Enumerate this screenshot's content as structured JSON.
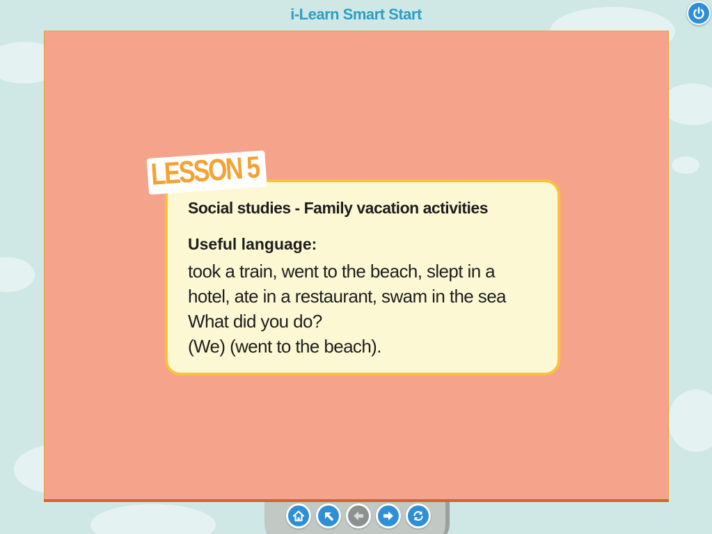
{
  "header": {
    "app_title": "i-Learn Smart Start",
    "power_icon": "power-icon"
  },
  "lesson": {
    "badge": "LESSON 5",
    "heading": "Social studies - Family vacation activities",
    "useful_language_title": "Useful language:",
    "lines": [
      "took a train, went to the beach, slept in a",
      "hotel, ate in a restaurant, swam in the sea",
      "What did you do?",
      "(We) (went to the beach)."
    ]
  },
  "navigation": {
    "buttons": [
      {
        "icon": "home-icon",
        "enabled": true
      },
      {
        "icon": "arrow-up-left-icon",
        "enabled": true
      },
      {
        "icon": "arrow-left-icon",
        "enabled": false
      },
      {
        "icon": "arrow-right-icon",
        "enabled": true
      },
      {
        "icon": "refresh-icon",
        "enabled": true
      }
    ]
  },
  "colors": {
    "background": "#cfe8e6",
    "slide": "#f6a38b",
    "card": "#fdf8d4",
    "card_border": "#f8c23a",
    "title": "#2b9fc4",
    "button": "#2f8fd6",
    "button_disabled": "#8a918e"
  }
}
